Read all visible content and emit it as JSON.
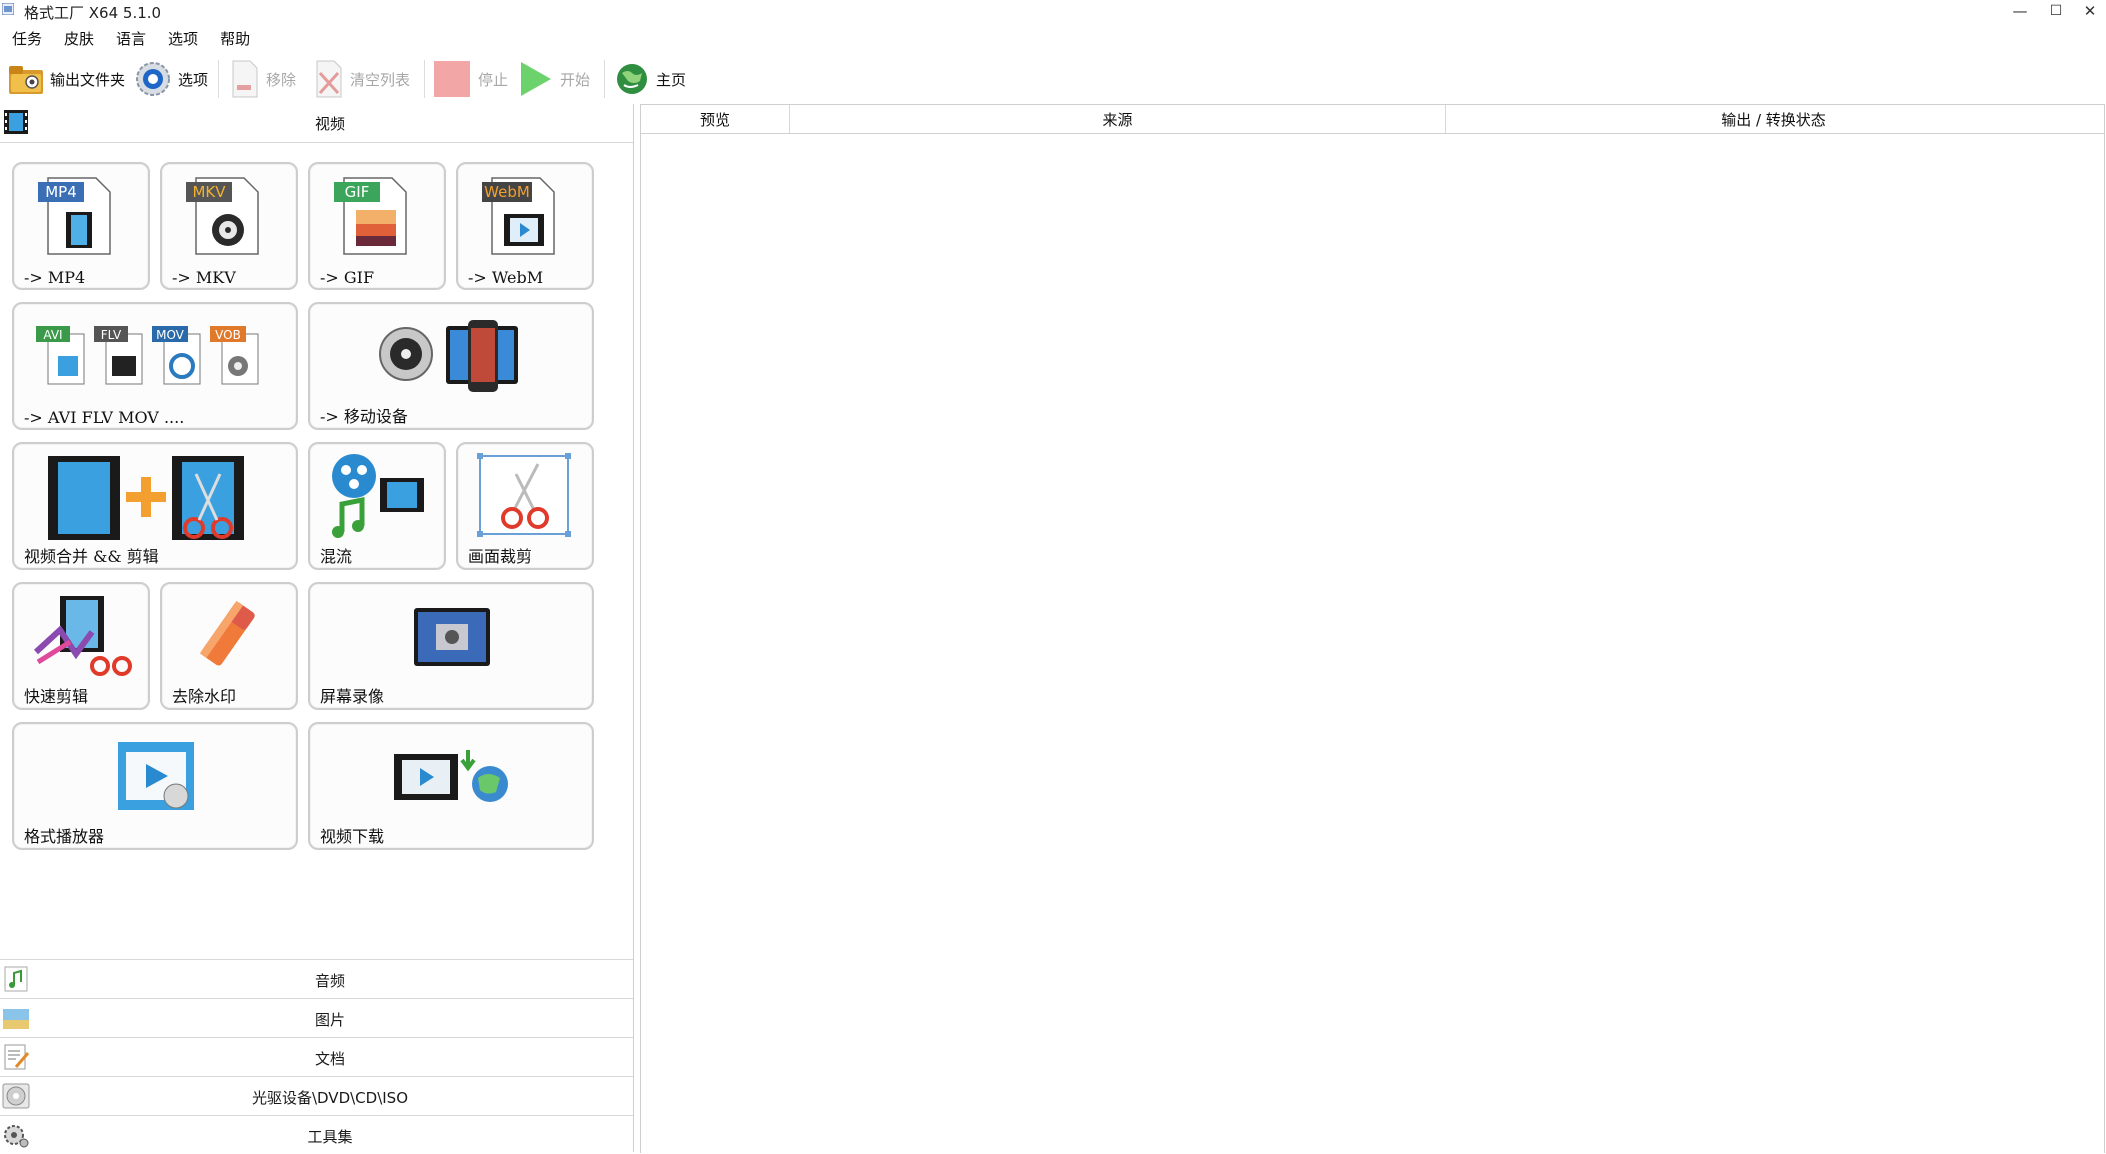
{
  "window": {
    "title": "格式工厂 X64 5.1.0",
    "minimize_glyph": "—",
    "maximize_glyph": "☐",
    "close_glyph": "✕"
  },
  "menu": [
    "任务",
    "皮肤",
    "语言",
    "选项",
    "帮助"
  ],
  "toolbar": {
    "output_folder": "输出文件夹",
    "options": "选项",
    "remove": "移除",
    "clear_list": "清空列表",
    "stop": "停止",
    "start": "开始",
    "home": "主页"
  },
  "left_panel": {
    "video_category": "视频",
    "tiles": [
      {
        "label": "-> MP4",
        "badge": "MP4"
      },
      {
        "label": "-> MKV",
        "badge": "MKV"
      },
      {
        "label": "-> GIF",
        "badge": "GIF"
      },
      {
        "label": "-> WebM",
        "badge": "WebM"
      },
      {
        "label": "-> AVI FLV MOV ....",
        "badges": [
          "AVI",
          "FLV",
          "MOV",
          "VOB"
        ]
      },
      {
        "label": "-> 移动设备"
      },
      {
        "label": "视频合并 && 剪辑"
      },
      {
        "label": "混流"
      },
      {
        "label": "画面裁剪"
      },
      {
        "label": "快速剪辑"
      },
      {
        "label": "去除水印"
      },
      {
        "label": "屏幕录像"
      },
      {
        "label": "格式播放器"
      },
      {
        "label": "视频下载"
      }
    ],
    "bottom_categories": [
      "音频",
      "图片",
      "文档",
      "光驱设备\\DVD\\CD\\ISO",
      "工具集"
    ]
  },
  "table": {
    "columns": [
      "预览",
      "来源",
      "输出 / 转换状态"
    ]
  },
  "colors": {
    "tile_border": "#cdcdcd",
    "mp4_badge": "#3a6fb5",
    "mkv_badge": "#555555",
    "gif_badge": "#3aa55b",
    "webm_badge": "#444444",
    "stop_red": "#f2a6a6",
    "start_green": "#6cd36c"
  }
}
